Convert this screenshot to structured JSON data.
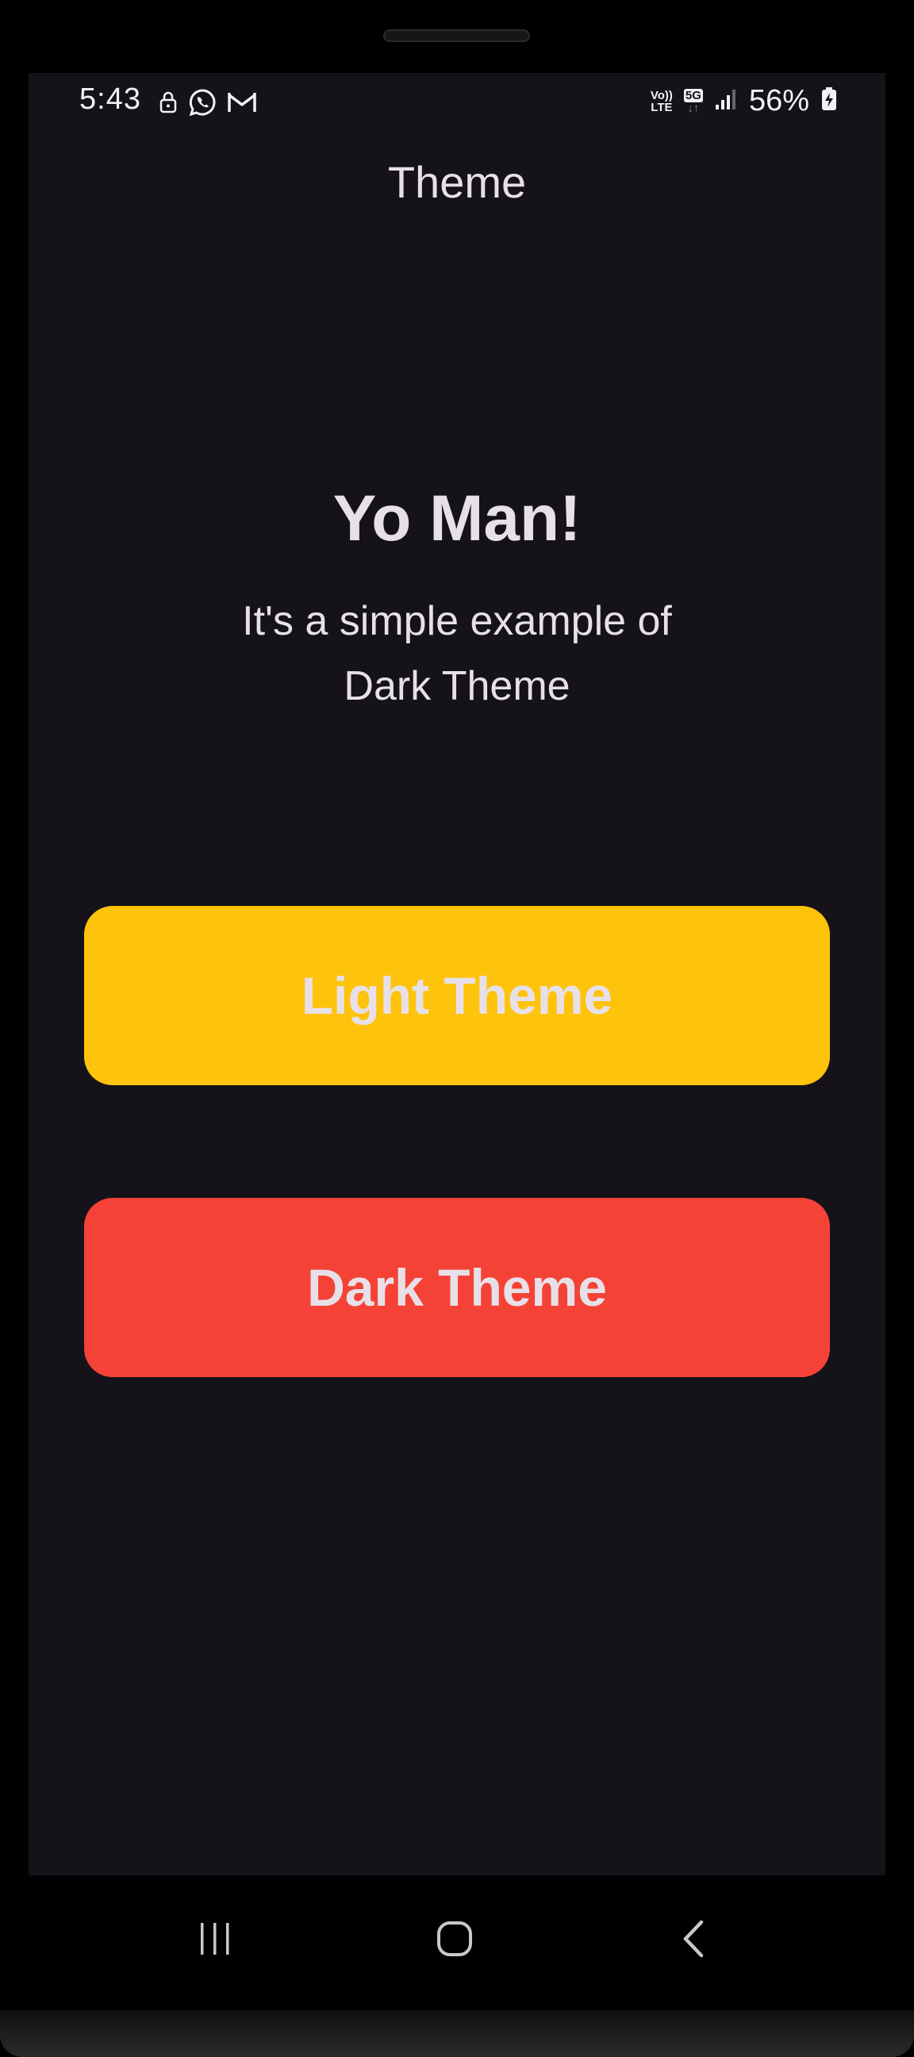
{
  "status_bar": {
    "time": "5:43",
    "left_icons": [
      "lock-icon",
      "whatsapp-icon",
      "gmail-icon"
    ],
    "volte_top": "Vo))",
    "volte_bottom": "LTE",
    "network": "5G",
    "battery_percent": "56%",
    "signal_bars_filled": 3
  },
  "app_bar": {
    "title": "Theme"
  },
  "content": {
    "heading": "Yo Man!",
    "subtitle": "It's a simple example of Dark Theme"
  },
  "buttons": {
    "light_label": "Light Theme",
    "light_color": "#fec30b",
    "dark_label": "Dark Theme",
    "dark_color": "#f44336"
  },
  "colors": {
    "background": "#15121a",
    "text": "#e6e1e6"
  },
  "navigation_bar": {
    "icons": [
      "recent-apps-icon",
      "home-icon",
      "back-icon"
    ]
  }
}
